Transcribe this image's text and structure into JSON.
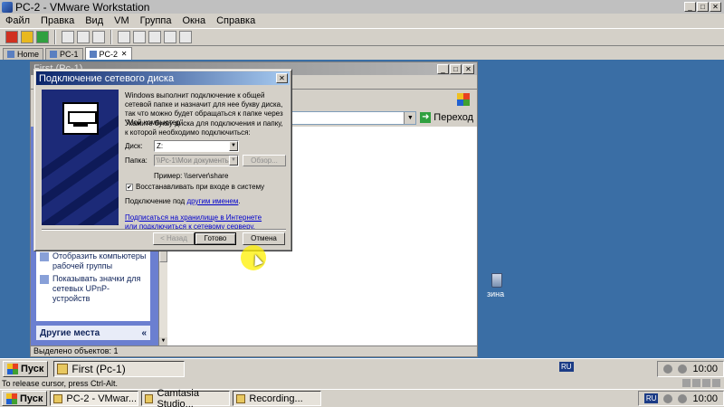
{
  "host": {
    "title": "PC-2 - VMware Workstation",
    "menu": [
      "Файл",
      "Правка",
      "Вид",
      "VM",
      "Группа",
      "Окна",
      "Справка"
    ],
    "tabs": [
      {
        "label": "Home",
        "active": false
      },
      {
        "label": "PC-1",
        "active": false
      },
      {
        "label": "PC-2",
        "active": true
      }
    ],
    "status_text": "To release cursor, press Ctrl-Alt.",
    "taskbar": {
      "start": "Пуск",
      "items": [
        "PC-2 - VMwar...",
        "Camtasia Studio...",
        "Recording..."
      ],
      "lang": "RU",
      "time": "10:00"
    }
  },
  "guest": {
    "explorer": {
      "title": "First (Pc-1)",
      "go_label": "Переход",
      "tasks": [
        "Отобразить компьютеры рабочей группы",
        "Показывать значки для сетевых UPnP-устройств"
      ],
      "other_places": "Другие места",
      "status": "Выделено объектов: 1"
    },
    "recycle_label": "зина",
    "taskbar": {
      "start": "Пуск",
      "window_button": "First (Pc-1)",
      "lang": "RU",
      "time": "10:00"
    }
  },
  "dialog": {
    "title": "Подключение сетевого диска",
    "intro": "Windows выполнит подключение к общей сетевой папке и назначит для нее букву диска, так что можно будет обращаться к папке через \"Мой компьютер\".",
    "prompt": "Укажите букву диска для подключения и папку, к которой необходимо подключиться:",
    "disk_label": "Диск:",
    "disk_value": "Z:",
    "folder_label": "Папка:",
    "folder_value": "\\\\Pc-1\\Мои документы",
    "browse_label": "Обзор...",
    "example": "Пример: \\\\server\\share",
    "reconnect_label": "Восстанавливать при входе в систему",
    "reconnect_checked": true,
    "connect_as_prefix": "Подключение под ",
    "connect_as_link": "другим именем",
    "subscribe_link": "Подписаться на хранилище в Интернете или подключиться к сетевому серверу.",
    "buttons": {
      "back": "< Назад",
      "finish": "Готово",
      "cancel": "Отмена"
    }
  }
}
